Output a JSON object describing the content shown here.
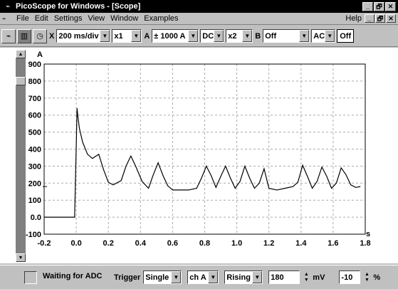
{
  "window": {
    "title": "PicoScope for Windows - [Scope]",
    "min_label": "_",
    "max_label": "🗗",
    "close_label": "✕"
  },
  "menu": {
    "items": [
      "File",
      "Edit",
      "Settings",
      "View",
      "Window",
      "Examples"
    ],
    "help": "Help",
    "min_label": "_",
    "restore_label": "🗗",
    "close_label": "✕"
  },
  "toolbar": {
    "timebase_prefix": "X",
    "timebase": "200 ms/div",
    "x_mult": "x1",
    "ch_a_label": "A",
    "ch_a_range": "± 1000 A",
    "ch_a_coupling": "DC",
    "ch_a_mult": "x2",
    "ch_b_label": "B",
    "ch_b_range": "Off",
    "ch_b_coupling": "AC",
    "ch_b_extra": "Off"
  },
  "status": {
    "text": "Waiting for ADC",
    "trigger_label": "Trigger",
    "trigger_mode": "Single",
    "trigger_channel": "ch A",
    "trigger_edge": "Rising",
    "threshold_value": "180",
    "threshold_unit": "mV",
    "pretrigger_value": "-10",
    "pretrigger_unit": "%"
  },
  "chart_data": {
    "type": "line",
    "xlabel": "s",
    "ylabel": "A",
    "xlim": [
      -0.2,
      1.8
    ],
    "ylim": [
      -100,
      900
    ],
    "x_ticks": [
      "-0.2",
      "0.0",
      "0.2",
      "0.4",
      "0.6",
      "0.8",
      "1.0",
      "1.2",
      "1.4",
      "1.6",
      "1.8"
    ],
    "y_ticks": [
      "-100",
      "0.0",
      "100",
      "200",
      "300",
      "400",
      "500",
      "600",
      "700",
      "800",
      "900"
    ],
    "grid": true,
    "series": [
      {
        "color": "#000000",
        "x": [
          -0.2,
          -0.01,
          0.0,
          0.005,
          0.01,
          0.02,
          0.04,
          0.07,
          0.1,
          0.14,
          0.17,
          0.2,
          0.23,
          0.28,
          0.31,
          0.34,
          0.37,
          0.41,
          0.45,
          0.48,
          0.51,
          0.54,
          0.57,
          0.6,
          0.65,
          0.7,
          0.75,
          0.78,
          0.81,
          0.84,
          0.87,
          0.9,
          0.93,
          0.96,
          0.99,
          1.02,
          1.05,
          1.08,
          1.11,
          1.14,
          1.17,
          1.2,
          1.25,
          1.3,
          1.35,
          1.38,
          1.41,
          1.44,
          1.47,
          1.5,
          1.53,
          1.56,
          1.59,
          1.62,
          1.65,
          1.68,
          1.71,
          1.74,
          1.77
        ],
        "values": [
          0,
          0,
          420,
          640,
          590,
          520,
          440,
          370,
          345,
          370,
          280,
          205,
          190,
          215,
          300,
          360,
          300,
          210,
          170,
          250,
          320,
          245,
          185,
          160,
          160,
          160,
          170,
          230,
          300,
          245,
          175,
          240,
          300,
          230,
          170,
          210,
          300,
          230,
          170,
          200,
          285,
          170,
          160,
          170,
          180,
          205,
          305,
          240,
          170,
          210,
          295,
          240,
          170,
          200,
          290,
          250,
          190,
          175,
          180
        ]
      }
    ]
  }
}
